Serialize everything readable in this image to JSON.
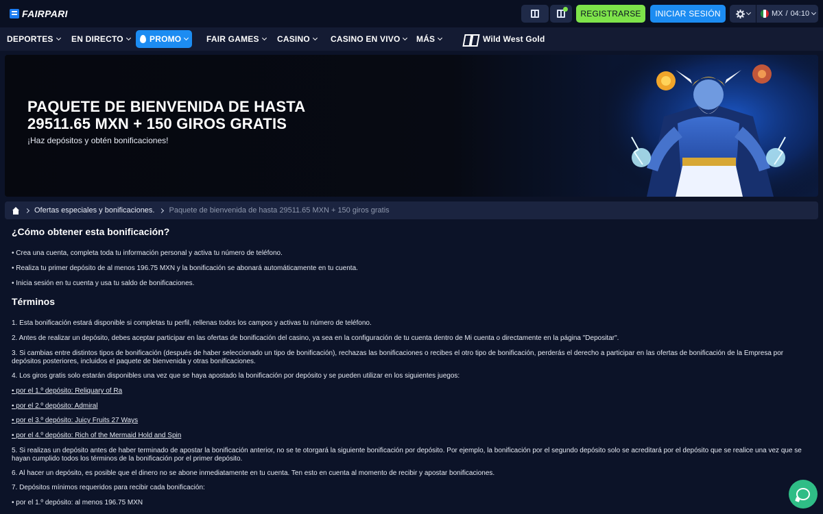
{
  "header": {
    "brand": "FAIRPARI",
    "register_label": "REGISTRARSE",
    "login_label": "INICIAR SESIÓN",
    "locale": "MX",
    "locale_sep": "/",
    "time": "04:10",
    "gift_icon": "gift-icon",
    "promo_icon": "promo-gift-icon",
    "settings_icon": "gear-icon"
  },
  "nav": {
    "items": [
      {
        "label": "DEPORTES"
      },
      {
        "label": "EN DIRECTO"
      },
      {
        "label": "PROMO"
      },
      {
        "label": "FAIR GAMES"
      },
      {
        "label": "CASINO"
      },
      {
        "label": "CASINO EN VIVO"
      },
      {
        "label": "MÁS"
      }
    ],
    "featured_game": "Wild West Gold"
  },
  "banner": {
    "title_line1": "PAQUETE DE BIENVENIDA DE HASTA",
    "title_line2": "29511.65 MXN + 150 GIROS GRATIS",
    "subtitle": "¡Haz depósitos y obtén bonificaciones!"
  },
  "breadcrumb": {
    "parent": "Ofertas especiales y bonificaciones.",
    "current": "Paquete de bienvenida de hasta 29511.65 MXN + 150 giros gratis"
  },
  "content": {
    "how_title": "¿Cómo obtener esta bonificación?",
    "how_items": [
      "• Crea una cuenta, completa toda tu información personal y activa tu número de teléfono.",
      "• Realiza tu primer depósito de al menos 196.75 MXN y la bonificación se abonará automáticamente en tu cuenta.",
      "• Inicia sesión en tu cuenta y usa tu saldo de bonificaciones."
    ],
    "terms_title": "Términos",
    "terms": [
      "1. Esta bonificación estará disponible si completas tu perfil, rellenas todos los campos y activas tu número de teléfono.",
      "2. Antes de realizar un depósito, debes aceptar participar en las ofertas de bonificación del casino, ya sea en la configuración de tu cuenta dentro de Mi cuenta o directamente en la página \"Depositar\".",
      "3. Si cambias entre distintos tipos de bonificación (después de haber seleccionado un tipo de bonificación), rechazas las bonificaciones o recibes el otro tipo de bonificación, perderás el derecho a participar en las ofertas de bonificación de la Empresa por depósitos posteriores, incluidos el paquete de bienvenida y otras bonificaciones.",
      "4. Los giros gratis solo estarán disponibles una vez que se haya apostado la bonificación por depósito y se pueden utilizar en los siguientes juegos:",
      "• por el 1.º depósito: Reliquary of Ra",
      "• por el 2.º depósito: Admiral",
      "• por el 3.º depósito: Juicy Fruits 27 Ways",
      "• por el 4.º depósito: Rich of the Mermaid Hold and Spin",
      "5. Si realizas un depósito antes de haber terminado de apostar la bonificación anterior, no se te otorgará la siguiente bonificación por depósito. Por ejemplo, la bonificación por el segundo depósito solo se acreditará por el depósito que se realice una vez que se hayan cumplido todos los términos de la bonificación por el primer depósito.",
      "6. Al hacer un depósito, es posible que el dinero no se abone inmediatamente en tu cuenta. Ten esto en cuenta al momento de recibir y apostar bonificaciones.",
      "7. Depósitos mínimos requeridos para recibir cada bonificación:",
      "• por el 1.º depósito: al menos 196.75 MXN"
    ]
  },
  "chat_icon": "chat-icon",
  "colors": {
    "background": "#0c1328",
    "register": "#7ee34a",
    "login": "#1c8cf2",
    "chat": "#2fbd86"
  }
}
